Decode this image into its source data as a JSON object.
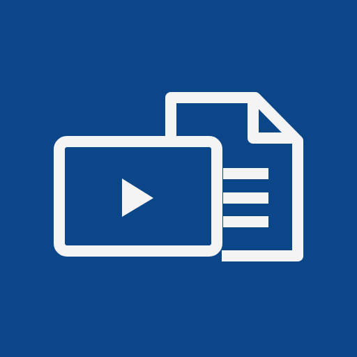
{
  "icon": {
    "name": "video-document-icon",
    "background_color": "#0a4688",
    "foreground_color": "#f4f4f4",
    "components": [
      "document-icon",
      "video-player-icon",
      "play-icon",
      "text-lines-icon"
    ]
  }
}
